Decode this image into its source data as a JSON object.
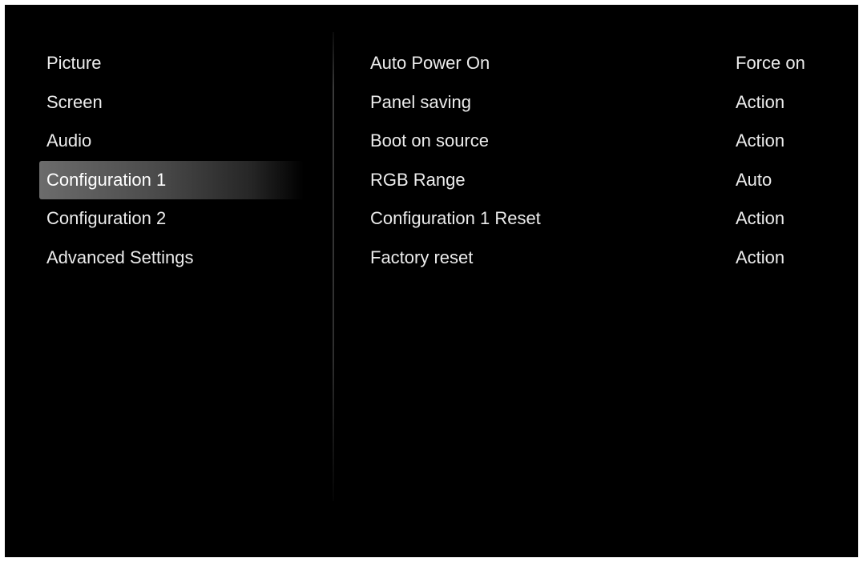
{
  "menu": {
    "items": [
      {
        "label": "Picture"
      },
      {
        "label": "Screen"
      },
      {
        "label": "Audio"
      },
      {
        "label": "Configuration 1"
      },
      {
        "label": "Configuration 2"
      },
      {
        "label": "Advanced Settings"
      }
    ],
    "selected": "Configuration 1"
  },
  "settings": {
    "rows": [
      {
        "label": "Auto Power On",
        "value": "Force on"
      },
      {
        "label": "Panel saving",
        "value": "Action"
      },
      {
        "label": "Boot on source",
        "value": "Action"
      },
      {
        "label": "RGB Range",
        "value": "Auto"
      },
      {
        "label": "Configuration 1 Reset",
        "value": "Action"
      },
      {
        "label": "Factory reset",
        "value": "Action"
      }
    ]
  },
  "colors": {
    "background": "#000000",
    "text": "#ececec",
    "selection_highlight": "#6c6c6c"
  }
}
